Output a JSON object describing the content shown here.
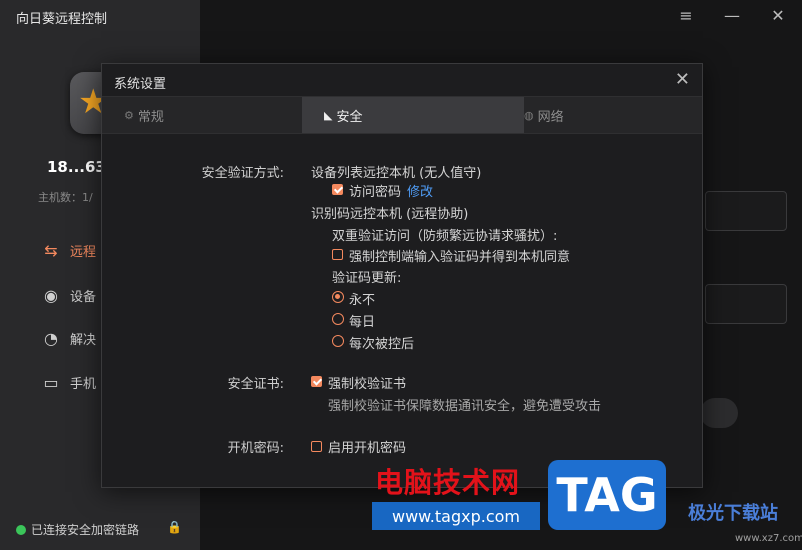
{
  "app": {
    "title": "向日葵远程控制"
  },
  "sidebar": {
    "device_id": "18...63",
    "host_count": "主机数：1/",
    "items": [
      {
        "label": "远程",
        "icon": "remote-arrows-icon",
        "active": true
      },
      {
        "label": "设备",
        "icon": "device-list-icon",
        "active": false
      },
      {
        "label": "解决",
        "icon": "solution-icon",
        "active": false
      },
      {
        "label": "手机",
        "icon": "screen-cast-icon",
        "active": false
      }
    ],
    "status": "已连接安全加密链路"
  },
  "window_controls": {
    "menu": "≡",
    "minimize": "—",
    "close": "✕"
  },
  "dialog": {
    "title": "系统设置",
    "close": "✕",
    "tabs": [
      {
        "label": "常规",
        "icon": "gear-icon",
        "active": false
      },
      {
        "label": "安全",
        "icon": "security-icon",
        "active": true
      },
      {
        "label": "网络",
        "icon": "network-icon",
        "active": false
      }
    ],
    "security_method": {
      "label": "安全验证方式:",
      "device_list_heading": "设备列表远控本机 (无人值守)",
      "access_password": {
        "label": "访问密码",
        "checked": true,
        "link": "修改"
      },
      "id_code_heading": "识别码远控本机 (远程协助)",
      "double_verify_heading": "双重验证访问（防频繁远协请求骚扰）:",
      "force_verify": {
        "label": "强制控制端输入验证码并得到本机同意",
        "checked": false
      },
      "code_update_heading": "验证码更新:",
      "code_update_options": [
        "永不",
        "每日",
        "每次被控后"
      ],
      "code_update_selected": 0
    },
    "certificate": {
      "label": "安全证书:",
      "force_check": {
        "label": "强制校验证书",
        "checked": true
      },
      "description": "强制校验证书保障数据通讯安全，避免遭受攻击"
    },
    "boot_password": {
      "label": "开机密码:",
      "enable": {
        "label": "启用开机密码",
        "checked": false
      }
    }
  },
  "watermark": {
    "cn_text": "电脑技术网",
    "url": "www.tagxp.com",
    "tag": "TAG",
    "site_logo": "极光下载站",
    "site_url": "www.xz7.com"
  },
  "colors": {
    "accent": "#f4895e",
    "link": "#4f9cf5",
    "status_ok": "#3bc55a",
    "sidebar_bg": "#29292b",
    "dialog_bg": "#1d1d1f"
  }
}
